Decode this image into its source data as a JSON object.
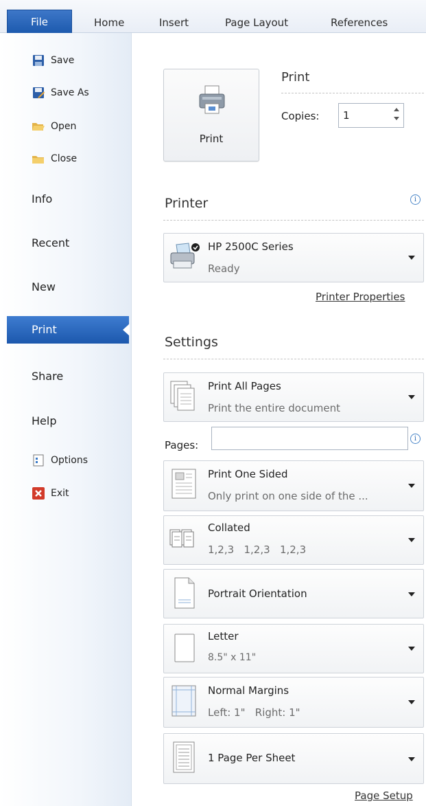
{
  "tabs": [
    {
      "label": "File",
      "active": true
    },
    {
      "label": "Home"
    },
    {
      "label": "Insert"
    },
    {
      "label": "Page Layout"
    },
    {
      "label": "References"
    }
  ],
  "nav": {
    "commands_top": [
      {
        "label": "Save",
        "icon": "save-icon"
      },
      {
        "label": "Save As",
        "icon": "save-as-icon"
      },
      {
        "label": "Open",
        "icon": "open-folder-icon"
      },
      {
        "label": "Close",
        "icon": "close-folder-icon"
      }
    ],
    "items": [
      {
        "label": "Info"
      },
      {
        "label": "Recent"
      },
      {
        "label": "New"
      },
      {
        "label": "Print",
        "selected": true
      },
      {
        "label": "Share"
      },
      {
        "label": "Help"
      }
    ],
    "commands_bottom": [
      {
        "label": "Options",
        "icon": "options-icon"
      },
      {
        "label": "Exit",
        "icon": "exit-icon"
      }
    ]
  },
  "print": {
    "heading": "Print",
    "button_label": "Print",
    "copies_label": "Copies:",
    "copies_value": "1"
  },
  "printer": {
    "heading": "Printer",
    "name": "HP 2500C Series",
    "status": "Ready",
    "properties_link": "Printer Properties"
  },
  "settings": {
    "heading": "Settings",
    "pages_label": "Pages:",
    "pages_value": "",
    "options": [
      {
        "title": "Print All Pages",
        "subtitle": "Print the entire document",
        "icon": "all-pages-icon"
      },
      {
        "title": "Print One Sided",
        "subtitle": "Only print on one side of the ...",
        "icon": "one-sided-icon"
      },
      {
        "title": "Collated",
        "subtitle": "1,2,3   1,2,3   1,2,3",
        "icon": "collated-icon"
      },
      {
        "title": "Portrait Orientation",
        "subtitle": "",
        "icon": "portrait-icon"
      },
      {
        "title": "Letter",
        "subtitle": "8.5\" x 11\"",
        "icon": "paper-size-icon"
      },
      {
        "title": "Normal Margins",
        "subtitle": "Left: 1\"   Right: 1\"",
        "icon": "margins-icon"
      },
      {
        "title": "1 Page Per Sheet",
        "subtitle": "",
        "icon": "pages-per-sheet-icon"
      }
    ],
    "page_setup_link": "Page Setup"
  },
  "colors": {
    "file_tab": "#1d5aae",
    "selected_nav": "#2a65b8",
    "info_icon": "#2a6ab4"
  }
}
